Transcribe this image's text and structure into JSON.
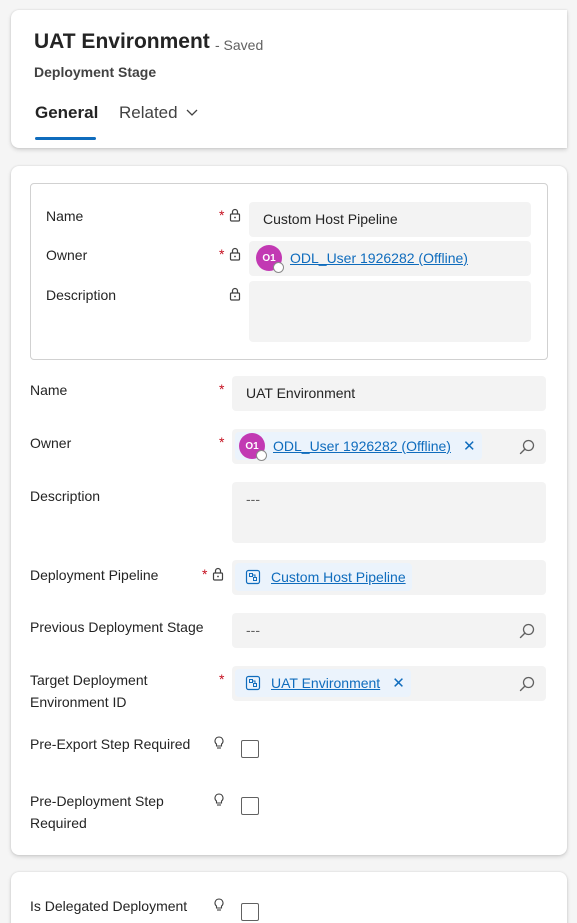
{
  "header": {
    "title": "UAT Environment",
    "saved_status": "- Saved",
    "entity_type": "Deployment Stage",
    "tabs": [
      {
        "label": "General"
      },
      {
        "label": "Related"
      }
    ]
  },
  "quick_view": {
    "name_label": "Name",
    "name_value": "Custom Host Pipeline",
    "owner_label": "Owner",
    "owner_initials": "O1",
    "owner_value": "ODL_User 1926282 (Offline)",
    "description_label": "Description",
    "description_value": ""
  },
  "form": {
    "name_label": "Name",
    "name_value": "UAT Environment",
    "owner_label": "Owner",
    "owner_initials": "O1",
    "owner_value": "ODL_User 1926282 (Offline)",
    "description_label": "Description",
    "description_placeholder": "---",
    "pipeline_label": "Deployment Pipeline",
    "pipeline_value": "Custom Host Pipeline",
    "previous_stage_label": "Previous Deployment Stage",
    "previous_stage_placeholder": "---",
    "target_env_label_line1": "Target Deployment",
    "target_env_label_line2": "Environment ID",
    "target_env_value": "UAT Environment",
    "pre_export_label": "Pre-Export Step Required",
    "pre_deploy_label_line1": "Pre-Deployment Step",
    "pre_deploy_label_line2": "Required",
    "required_marker": "*"
  },
  "bottom": {
    "delegated_label": "Is Delegated Deployment"
  },
  "colors": {
    "accent": "#0f6cbd",
    "required": "#c50f1f",
    "avatar": "#c239b3"
  }
}
